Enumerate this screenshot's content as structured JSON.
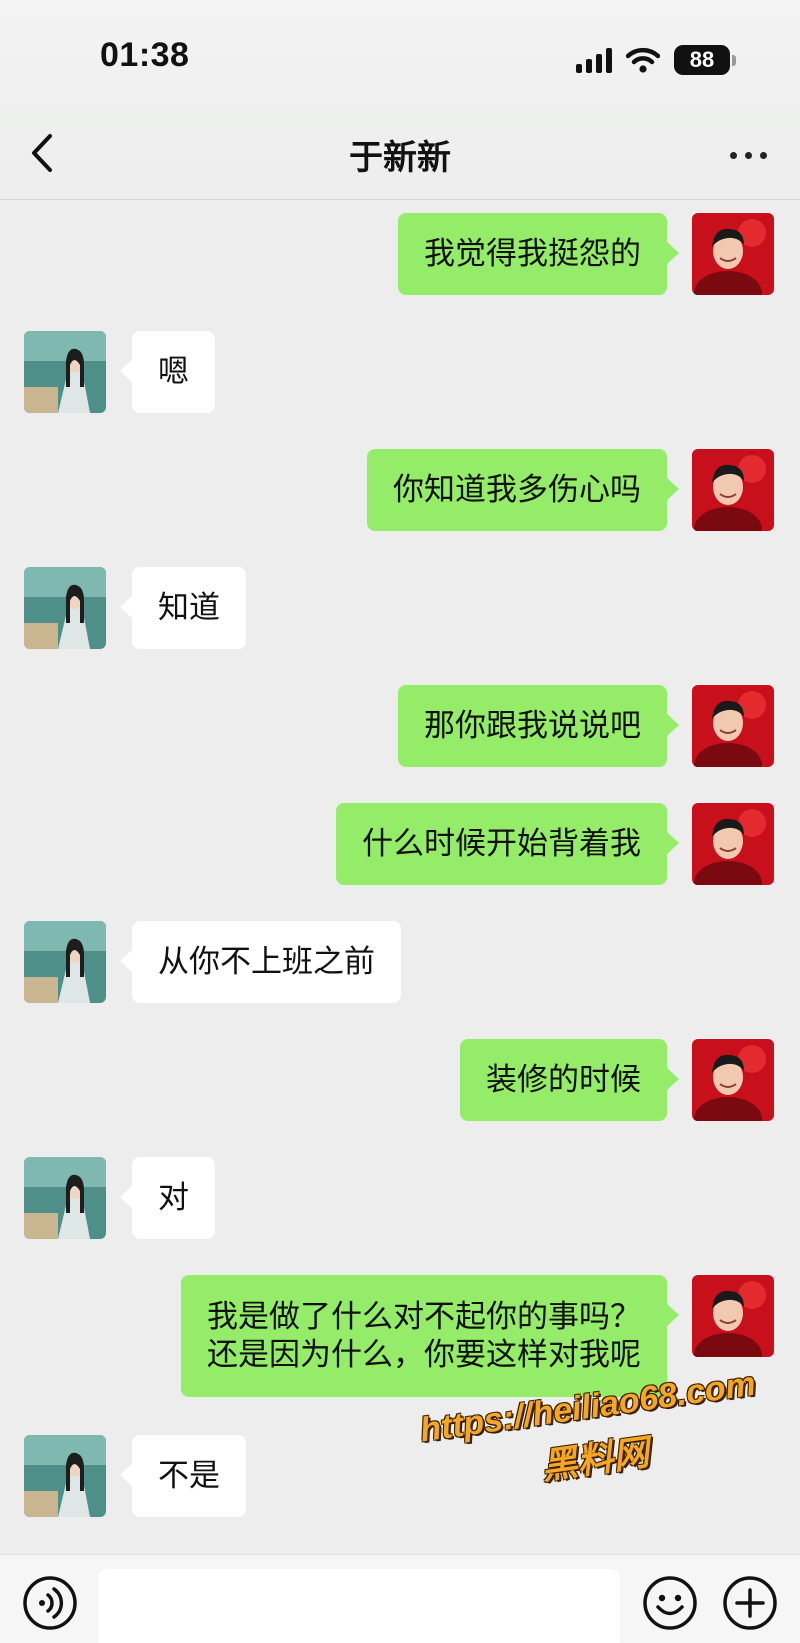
{
  "status_bar": {
    "time": "01:38",
    "battery": "88"
  },
  "nav": {
    "title": "于新新",
    "back_icon": "chevron-left-icon",
    "more_icon": "ellipsis-icon"
  },
  "colors": {
    "my_bubble": "#95ec69",
    "their_bubble": "#ffffff",
    "background": "#ededed"
  },
  "messages": [
    {
      "sender": "me",
      "text": "我觉得我挺怨的"
    },
    {
      "sender": "them",
      "text": "嗯"
    },
    {
      "sender": "me",
      "text": "你知道我多伤心吗"
    },
    {
      "sender": "them",
      "text": "知道"
    },
    {
      "sender": "me",
      "text": "那你跟我说说吧"
    },
    {
      "sender": "me",
      "text": "什么时候开始背着我"
    },
    {
      "sender": "them",
      "text": "从你不上班之前"
    },
    {
      "sender": "me",
      "text": "装修的时候"
    },
    {
      "sender": "them",
      "text": "对"
    },
    {
      "sender": "me",
      "text": "我是做了什么对不起你的事吗？\n还是因为什么，你要这样对我呢"
    },
    {
      "sender": "them",
      "text": "不是"
    }
  ],
  "watermark": {
    "url": "https://heiliao68.com",
    "name": "黑料网"
  },
  "input_bar": {
    "placeholder": "",
    "voice_icon": "voice-icon",
    "emoji_icon": "emoji-icon",
    "plus_icon": "plus-icon"
  }
}
